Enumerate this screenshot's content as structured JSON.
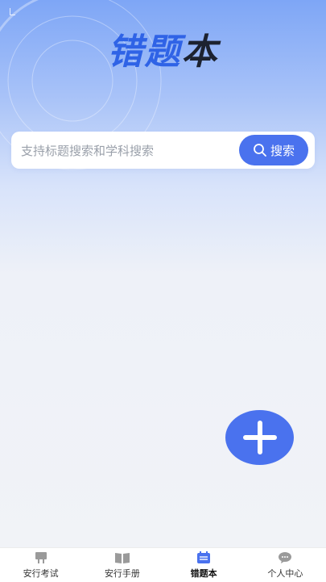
{
  "header": {
    "title_part1": "错",
    "title_part2": "题",
    "title_part3": "本"
  },
  "search": {
    "placeholder": "支持标题搜索和学科搜索",
    "button_label": "搜索"
  },
  "tabs": [
    {
      "label": "安行考试",
      "icon": "desk-icon",
      "active": false
    },
    {
      "label": "安行手册",
      "icon": "book-icon",
      "active": false
    },
    {
      "label": "错题本",
      "icon": "notebook-icon",
      "active": true
    },
    {
      "label": "个人中心",
      "icon": "chat-bubble-icon",
      "active": false
    }
  ],
  "colors": {
    "accent": "#4a72ee",
    "title_blue": "#2f63e6",
    "title_dark": "#1c2230"
  }
}
